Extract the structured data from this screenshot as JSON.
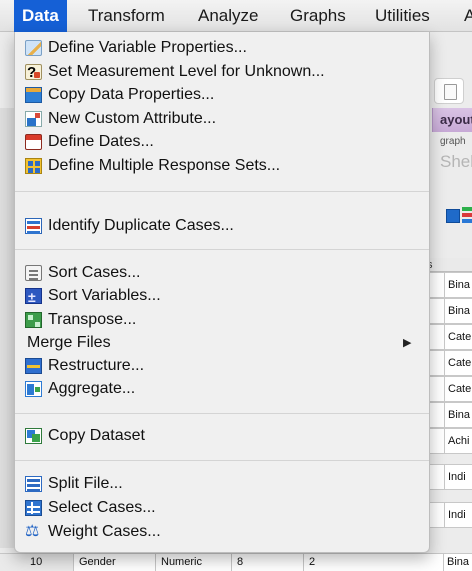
{
  "menubar": {
    "items": [
      "Data",
      "Transform",
      "Analyze",
      "Graphs",
      "Utilities",
      "A"
    ]
  },
  "background": {
    "tab_label": "ayout",
    "sub_label": "graph",
    "field_text": "Shell_",
    "col_header": "s",
    "grid_cells": [
      "Bina",
      "Bina",
      "Cate",
      "Cate",
      "Cate",
      "Bina",
      "Achi",
      "Indi",
      "Indi"
    ],
    "bottom_row": {
      "row_num": "10",
      "name": "Gender",
      "type": "Numeric",
      "width": "8",
      "decimals": "2",
      "label": "Bina"
    }
  },
  "data_menu": {
    "groups": [
      [
        "Define Variable Properties...",
        "Set Measurement Level for Unknown...",
        "Copy Data Properties...",
        "New Custom Attribute...",
        "Define Dates...",
        "Define Multiple Response Sets..."
      ],
      [
        "Identify Duplicate Cases..."
      ],
      [
        "Sort Cases...",
        "Sort Variables...",
        "Transpose...",
        "Merge Files",
        "Restructure...",
        "Aggregate..."
      ],
      [
        "Copy Dataset"
      ],
      [
        "Split File...",
        "Select Cases...",
        "Weight Cases..."
      ]
    ],
    "submenu_arrow": "▶",
    "icons": [
      "define-variable-properties-icon",
      "set-measurement-level-icon",
      "copy-data-properties-icon",
      "new-custom-attribute-icon",
      "define-dates-icon",
      "define-multiple-response-sets-icon",
      "identify-duplicate-cases-icon",
      "sort-cases-icon",
      "sort-variables-icon",
      "transpose-icon",
      "restructure-icon",
      "aggregate-icon",
      "copy-dataset-icon",
      "split-file-icon",
      "select-cases-icon",
      "weight-cases-icon"
    ]
  }
}
